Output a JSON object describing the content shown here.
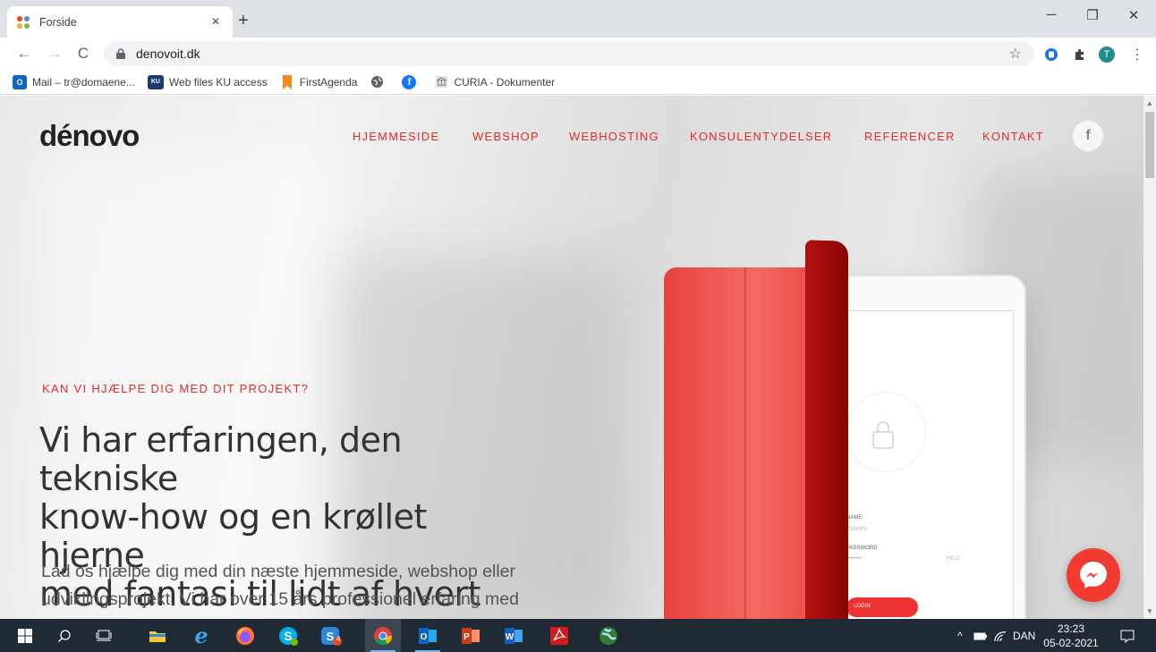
{
  "browser": {
    "tab_title": "Forside",
    "tab_close": "×",
    "new_tab": "+",
    "url": "denovoit.dk",
    "window_controls": {
      "minimize": "─",
      "restore": "❐",
      "close": "✕"
    },
    "nav": {
      "back": "←",
      "forward": "→",
      "reload": "C"
    },
    "star": "☆",
    "profile_initial": "T",
    "menu": "⋮"
  },
  "bookmarks": [
    {
      "label": "Mail – tr@domaene...",
      "icon": "outlook-icon",
      "color": "#0a64c2"
    },
    {
      "label": "Web files KU access",
      "icon": "ku-icon",
      "color": "#1e3a6e"
    },
    {
      "label": "FirstAgenda",
      "icon": "bookmark-flag-icon",
      "color": "#f28a1f"
    },
    {
      "label": "",
      "icon": "globe-icon",
      "color": "#5f6368"
    },
    {
      "label": "",
      "icon": "facebook-icon",
      "color": "#1877f2"
    },
    {
      "label": "CURIA - Dokumenter",
      "icon": "curia-icon",
      "color": "#9aa0a6"
    }
  ],
  "site": {
    "logo": "dénovo",
    "nav": [
      "HJEMMESIDE",
      "WEBSHOP",
      "WEBHOSTING",
      "KONSULENTYDELSER",
      "REFERENCER",
      "KONTAKT"
    ],
    "facebook": "f",
    "kicker": "KAN VI HJÆLPE DIG MED DIT PROJEKT?",
    "headline": [
      "Vi har erfaringen, den tekniske",
      "know-how og en krøllet hjerne",
      "med fantasi til lidt af hvert"
    ],
    "lead": [
      "Lad os hjælpe dig med din næste hjemmeside, webshop eller",
      "udviklingsprojekt. Vi har over 15 års professionel erfaring med"
    ],
    "accent_color": "#e62b2b",
    "tablet": {
      "name_label": "NAME",
      "name_value": "Stanley",
      "password_label": "PASSWORD",
      "password_value": "••••••••",
      "help": "HELP",
      "login": "LOGIN"
    }
  },
  "taskbar": {
    "apps": [
      "windows-start-icon",
      "search-icon",
      "task-view-icon",
      "file-explorer-icon",
      "internet-explorer-icon",
      "firefox-icon",
      "skype-icon",
      "skype-business-icon",
      "chrome-icon",
      "outlook-icon",
      "powerpoint-icon",
      "word-icon",
      "acrobat-icon",
      "globe-app-icon"
    ],
    "skype_business_badge": "4",
    "language": "DAN",
    "time": "23:23",
    "date": "05-02-2021",
    "chevron": "^"
  }
}
